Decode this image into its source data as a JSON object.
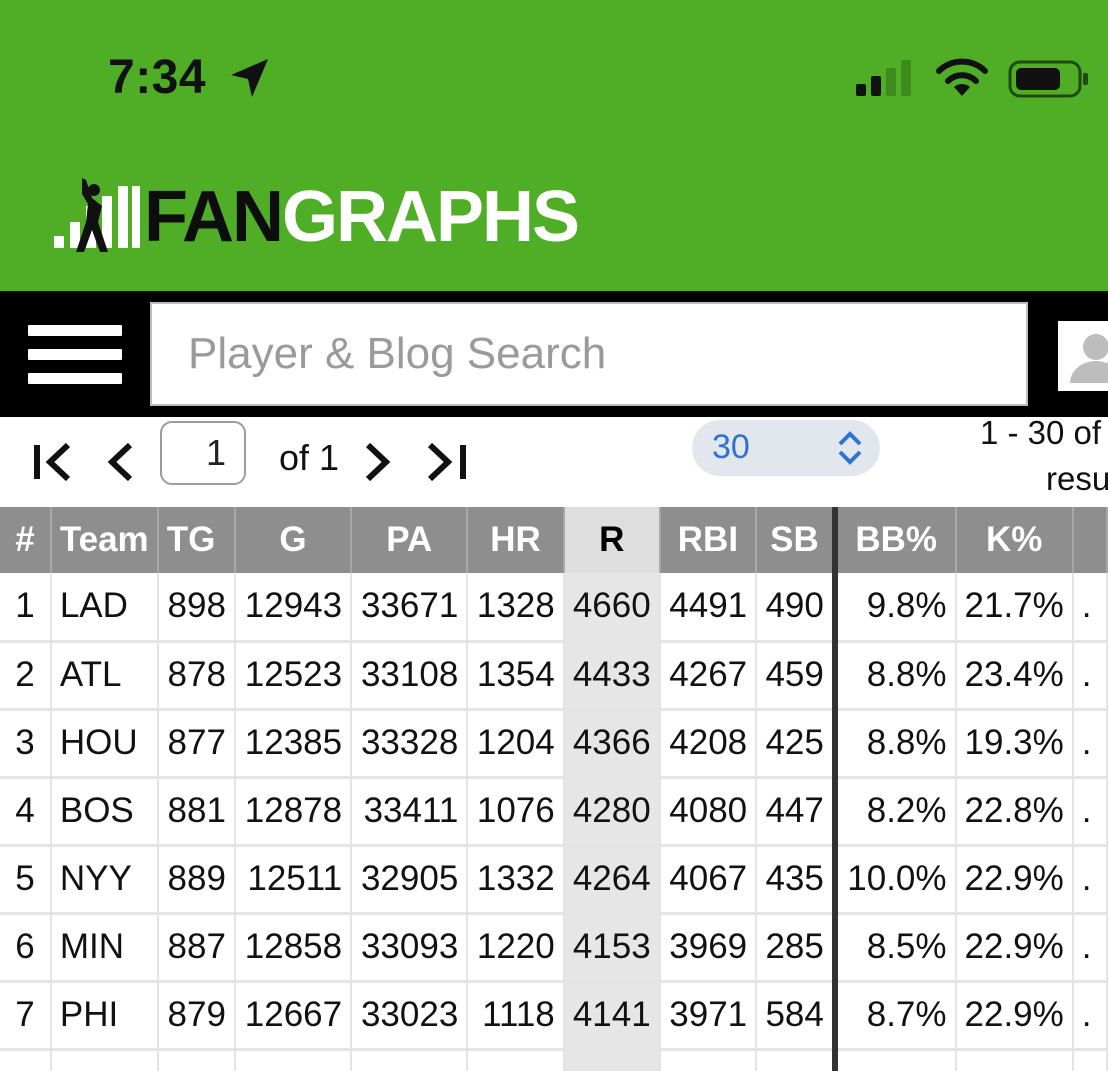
{
  "status_bar": {
    "time": "7:34",
    "icons": [
      "location-arrow-icon",
      "cellular-signal-icon",
      "wifi-icon",
      "battery-icon"
    ]
  },
  "brand": {
    "logo_fan": "FAN",
    "logo_graphs": "GRAPHS",
    "header_color": "#50ae26"
  },
  "search": {
    "placeholder": "Player & Blog Search"
  },
  "pagination": {
    "page": "1",
    "of_label": "of 1",
    "per_page": "30",
    "results_line1": "1 - 30 of",
    "results_line2": "resu"
  },
  "table": {
    "columns": [
      "#",
      "Team",
      "TG",
      "G",
      "PA",
      "HR",
      "R",
      "RBI",
      "SB",
      "BB%",
      "K%"
    ],
    "sorted_column": "R",
    "rows": [
      {
        "n": "1",
        "team": "LAD",
        "tg": "898",
        "g": "12943",
        "pa": "33671",
        "hr": "1328",
        "r": "4660",
        "rbi": "4491",
        "sb": "490",
        "bb": "9.8%",
        "k": "21.7%"
      },
      {
        "n": "2",
        "team": "ATL",
        "tg": "878",
        "g": "12523",
        "pa": "33108",
        "hr": "1354",
        "r": "4433",
        "rbi": "4267",
        "sb": "459",
        "bb": "8.8%",
        "k": "23.4%"
      },
      {
        "n": "3",
        "team": "HOU",
        "tg": "877",
        "g": "12385",
        "pa": "33328",
        "hr": "1204",
        "r": "4366",
        "rbi": "4208",
        "sb": "425",
        "bb": "8.8%",
        "k": "19.3%"
      },
      {
        "n": "4",
        "team": "BOS",
        "tg": "881",
        "g": "12878",
        "pa": "33411",
        "hr": "1076",
        "r": "4280",
        "rbi": "4080",
        "sb": "447",
        "bb": "8.2%",
        "k": "22.8%"
      },
      {
        "n": "5",
        "team": "NYY",
        "tg": "889",
        "g": "12511",
        "pa": "32905",
        "hr": "1332",
        "r": "4264",
        "rbi": "4067",
        "sb": "435",
        "bb": "10.0%",
        "k": "22.9%"
      },
      {
        "n": "6",
        "team": "MIN",
        "tg": "887",
        "g": "12858",
        "pa": "33093",
        "hr": "1220",
        "r": "4153",
        "rbi": "3969",
        "sb": "285",
        "bb": "8.5%",
        "k": "22.9%"
      },
      {
        "n": "7",
        "team": "PHI",
        "tg": "879",
        "g": "12667",
        "pa": "33023",
        "hr": "1118",
        "r": "4141",
        "rbi": "3971",
        "sb": "584",
        "bb": "8.7%",
        "k": "22.9%"
      }
    ]
  }
}
